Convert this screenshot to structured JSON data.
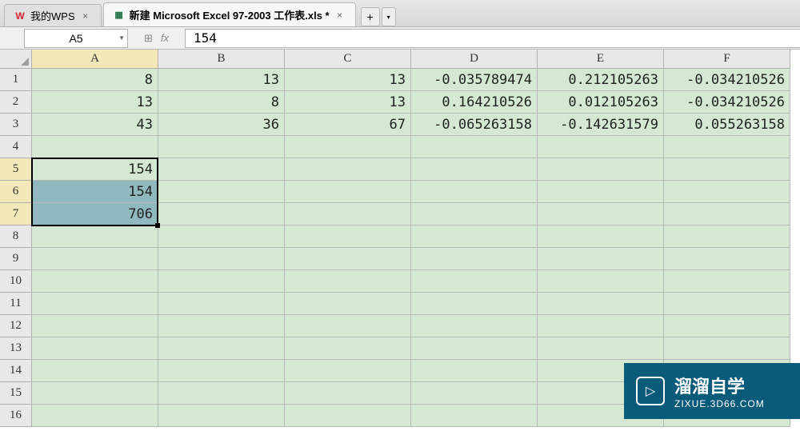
{
  "tabs": {
    "tab1_label": "我的WPS",
    "tab2_label": "新建 Microsoft Excel 97-2003 工作表.xls *"
  },
  "name_box": "A5",
  "formula_bar": "154",
  "columns": [
    "A",
    "B",
    "C",
    "D",
    "E",
    "F"
  ],
  "rows": [
    "1",
    "2",
    "3",
    "4",
    "5",
    "6",
    "7",
    "8",
    "9",
    "10",
    "11",
    "12",
    "13",
    "14",
    "15",
    "16"
  ],
  "cells": {
    "r1": {
      "A": "8",
      "B": "13",
      "C": "13",
      "D": "-0.035789474",
      "E": "0.212105263",
      "F": "-0.034210526"
    },
    "r2": {
      "A": "13",
      "B": "8",
      "C": "13",
      "D": "0.164210526",
      "E": "0.012105263",
      "F": "-0.034210526"
    },
    "r3": {
      "A": "43",
      "B": "36",
      "C": "67",
      "D": "-0.065263158",
      "E": "-0.142631579",
      "F": "0.055263158"
    },
    "r4": {
      "A": "",
      "B": "",
      "C": "",
      "D": "",
      "E": "",
      "F": ""
    },
    "r5": {
      "A": "154",
      "B": "",
      "C": "",
      "D": "",
      "E": "",
      "F": ""
    },
    "r6": {
      "A": "154",
      "B": "",
      "C": "",
      "D": "",
      "E": "",
      "F": ""
    },
    "r7": {
      "A": "706",
      "B": "",
      "C": "",
      "D": "",
      "E": "",
      "F": ""
    }
  },
  "watermark": {
    "title": "溜溜自学",
    "url": "ZIXUE.3D66.COM"
  }
}
